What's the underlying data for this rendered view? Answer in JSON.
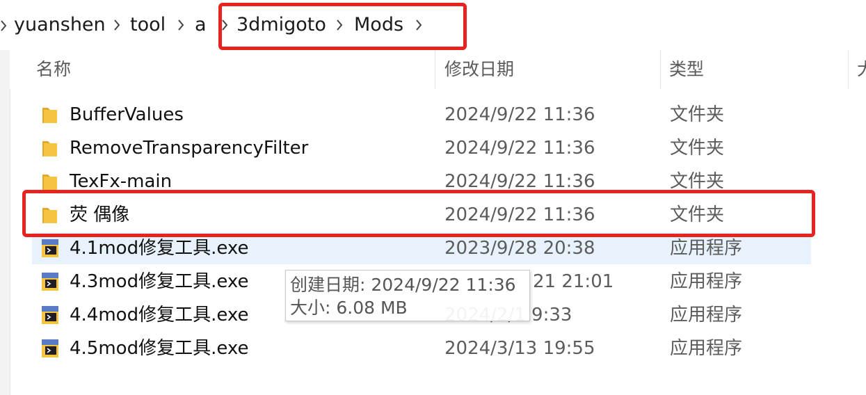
{
  "breadcrumb": {
    "items": [
      "yuanshen",
      "tool",
      "a",
      "3dmigoto",
      "Mods"
    ]
  },
  "columns": {
    "name": "名称",
    "date_modified": "修改日期",
    "type": "类型",
    "size_partial": "大"
  },
  "rows": [
    {
      "name": "BufferValues",
      "date": "2024/9/22 11:36",
      "type": "文件夹",
      "icon": "folder-icon"
    },
    {
      "name": "RemoveTransparencyFilter",
      "date": "2024/9/22 11:36",
      "type": "文件夹",
      "icon": "folder-icon"
    },
    {
      "name": "TexFx-main",
      "date": "2024/9/22 11:36",
      "type": "文件夹",
      "icon": "folder-icon"
    },
    {
      "name": "荧 偶像",
      "date": "2024/9/22 11:36",
      "type": "文件夹",
      "icon": "folder-icon"
    },
    {
      "name": "4.1mod修复工具.exe",
      "date": "2023/9/28 20:38",
      "type": "应用程序",
      "icon": "exe-icon"
    },
    {
      "name": "4.3mod修复工具.exe",
      "date": "21 21:01",
      "type": "应用程序",
      "icon": "exe-icon"
    },
    {
      "name": "4.4mod修复工具.exe",
      "date": "2024/2/1 9:33",
      "type": "应用程序",
      "icon": "exe-icon"
    },
    {
      "name": "4.5mod修复工具.exe",
      "date": "2024/3/13 19:55",
      "type": "应用程序",
      "icon": "exe-icon"
    }
  ],
  "tooltip": {
    "created": "创建日期: 2024/9/22 11:36",
    "size": "大小: 6.08 MB"
  },
  "colors": {
    "highlight": "#e8231f",
    "selected_row": "#e8f2fc",
    "folder": "#f5c242"
  }
}
